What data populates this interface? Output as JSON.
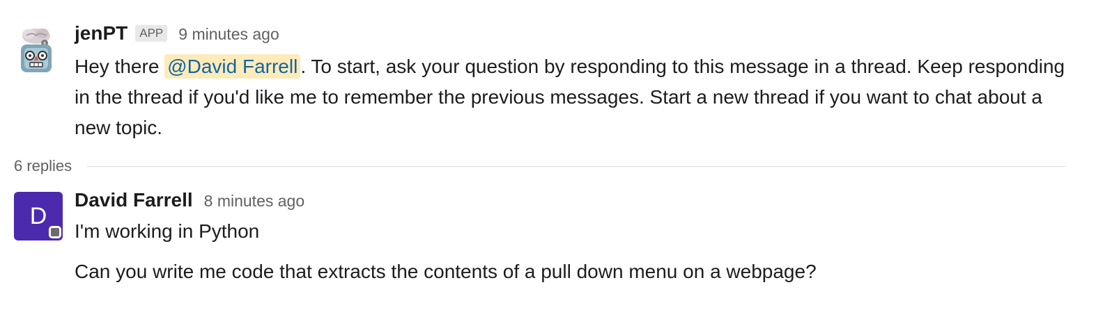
{
  "messages": [
    {
      "author": "jenPT",
      "badge": "APP",
      "time": "9 minutes ago",
      "text_before": "Hey there ",
      "mention": "@David Farrell",
      "text_after": ". To start, ask your question by responding to this message in a thread. Keep responding in the thread if you'd like me to remember the previous messages. Start a new thread if you want to chat about a new topic."
    },
    {
      "author": "David Farrell",
      "avatar_letter": "D",
      "time": "8 minutes ago",
      "line1": "I'm working in Python",
      "line2": "Can you write me code that extracts the contents of a pull down menu on a webpage?"
    }
  ],
  "thread": {
    "replies_label": "6 replies"
  },
  "icons": {
    "bot_avatar": "robot-brain-icon",
    "presence": "status-away-icon"
  },
  "colors": {
    "mention_bg": "#fdebba",
    "mention_text": "#1264a3",
    "user_avatar_bg": "#4b2aad"
  }
}
